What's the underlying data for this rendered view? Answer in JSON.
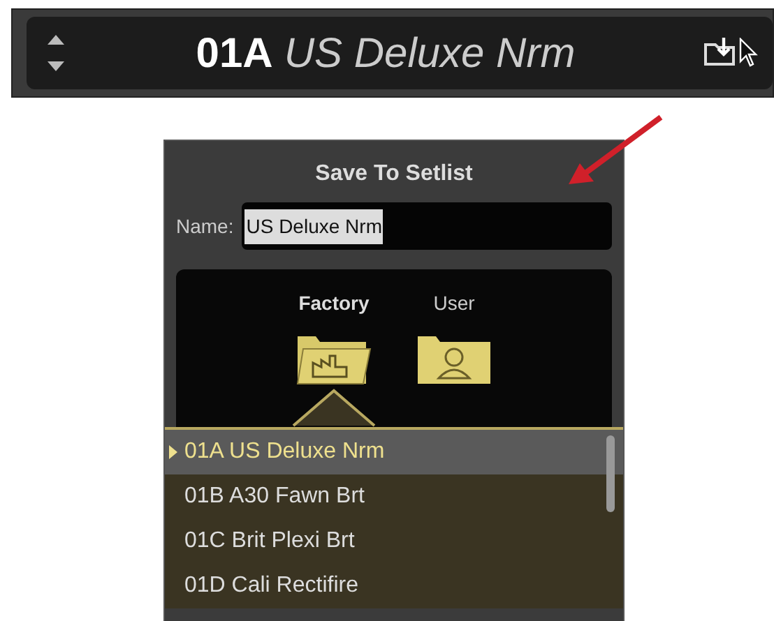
{
  "preset_bar": {
    "number": "01A",
    "name": "US Deluxe Nrm"
  },
  "dialog": {
    "title": "Save To Setlist",
    "name_label": "Name:",
    "name_value": "US Deluxe Nrm",
    "tabs": [
      {
        "label": "Factory",
        "selected": true
      },
      {
        "label": "User",
        "selected": false
      }
    ],
    "setlist": [
      {
        "label": "01A US Deluxe Nrm",
        "selected": true
      },
      {
        "label": "01B A30 Fawn Brt",
        "selected": false
      },
      {
        "label": "01C Brit Plexi Brt",
        "selected": false
      },
      {
        "label": "01D Cali Rectifire",
        "selected": false
      }
    ]
  }
}
